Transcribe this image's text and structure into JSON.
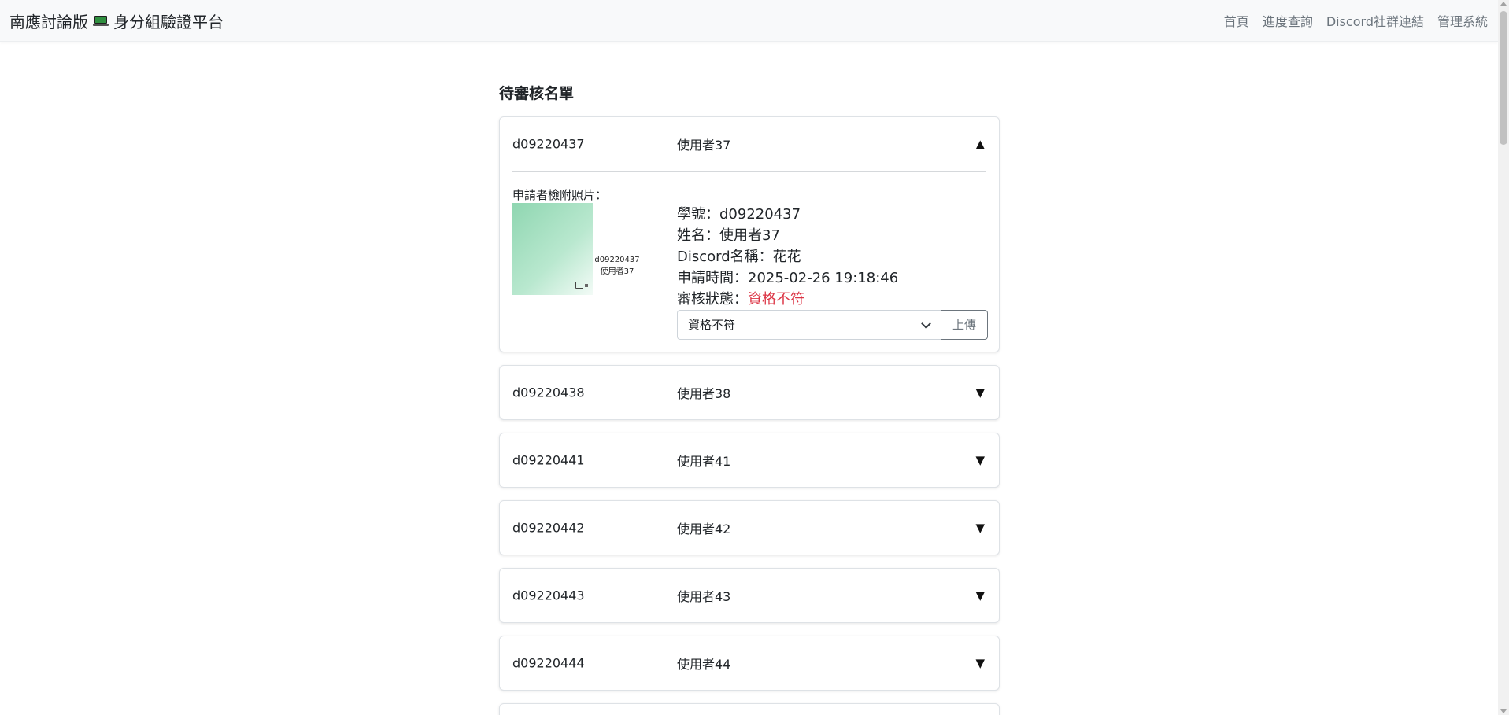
{
  "navbar": {
    "brand_prefix": "南應討論版",
    "brand_icon": "laptop-icon",
    "brand_suffix": "身分組驗證平台",
    "links": [
      "首頁",
      "進度查詢",
      "Discord社群連結",
      "管理系統"
    ]
  },
  "page_title": "待審核名單",
  "expanded": {
    "id": "d09220437",
    "name": "使用者37",
    "toggle": "▲",
    "photo_label": "申請者檢附照片：",
    "photo_text_id": "d09220437",
    "photo_text_name": "使用者37",
    "info": {
      "student_id": "學號：d09220437",
      "name": "姓名：使用者37",
      "discord": "Discord名稱：花花",
      "time": "申請時間：2025-02-26 19:18:46",
      "status_label": "審核狀態：",
      "status_value": "資格不符"
    },
    "select_value": "資格不符",
    "upload_label": "上傳"
  },
  "collapsed": [
    {
      "id": "d09220438",
      "name": "使用者38",
      "toggle": "▼"
    },
    {
      "id": "d09220441",
      "name": "使用者41",
      "toggle": "▼"
    },
    {
      "id": "d09220442",
      "name": "使用者42",
      "toggle": "▼"
    },
    {
      "id": "d09220443",
      "name": "使用者43",
      "toggle": "▼"
    },
    {
      "id": "d09220444",
      "name": "使用者44",
      "toggle": "▼"
    }
  ],
  "colors": {
    "status_red": "#dc3545",
    "navbar_bg": "#f8f9fa",
    "link_gray": "#6c757d"
  }
}
